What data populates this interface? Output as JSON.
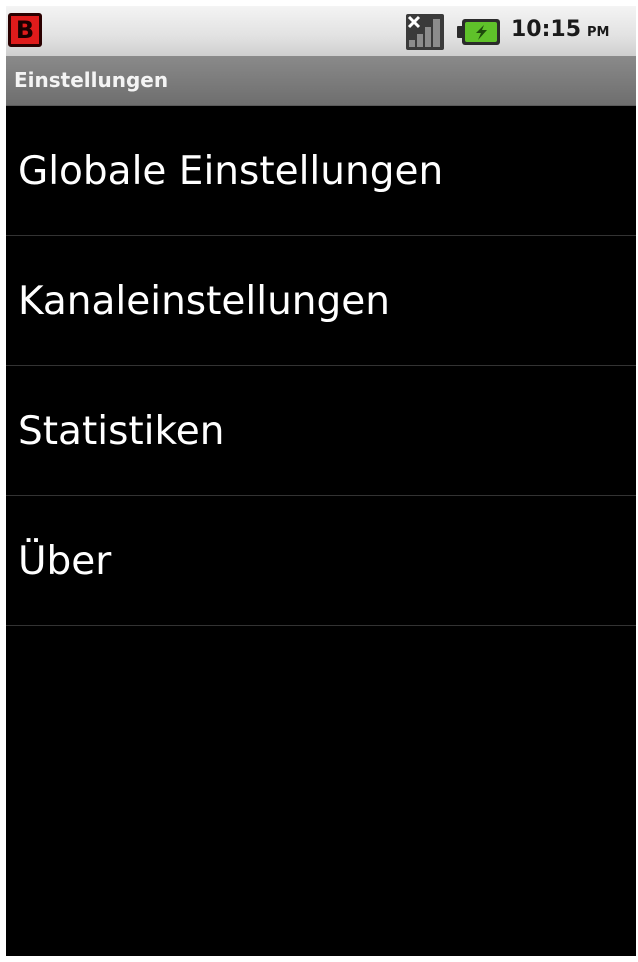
{
  "status_bar": {
    "notification_icon": "b-app-icon",
    "notification_letter": "B",
    "signal_icon": "signal-no-sim-icon",
    "battery_icon": "battery-charging-icon",
    "time": "10:15",
    "ampm": "PM"
  },
  "title_bar": {
    "title": "Einstellungen"
  },
  "preferences": {
    "items": [
      {
        "label": "Globale Einstellungen"
      },
      {
        "label": "Kanaleinstellungen"
      },
      {
        "label": "Statistiken"
      },
      {
        "label": "Über"
      }
    ]
  },
  "colors": {
    "background": "#000000",
    "notification_icon": "#e01b1b",
    "battery_fill": "#5fc12a"
  }
}
